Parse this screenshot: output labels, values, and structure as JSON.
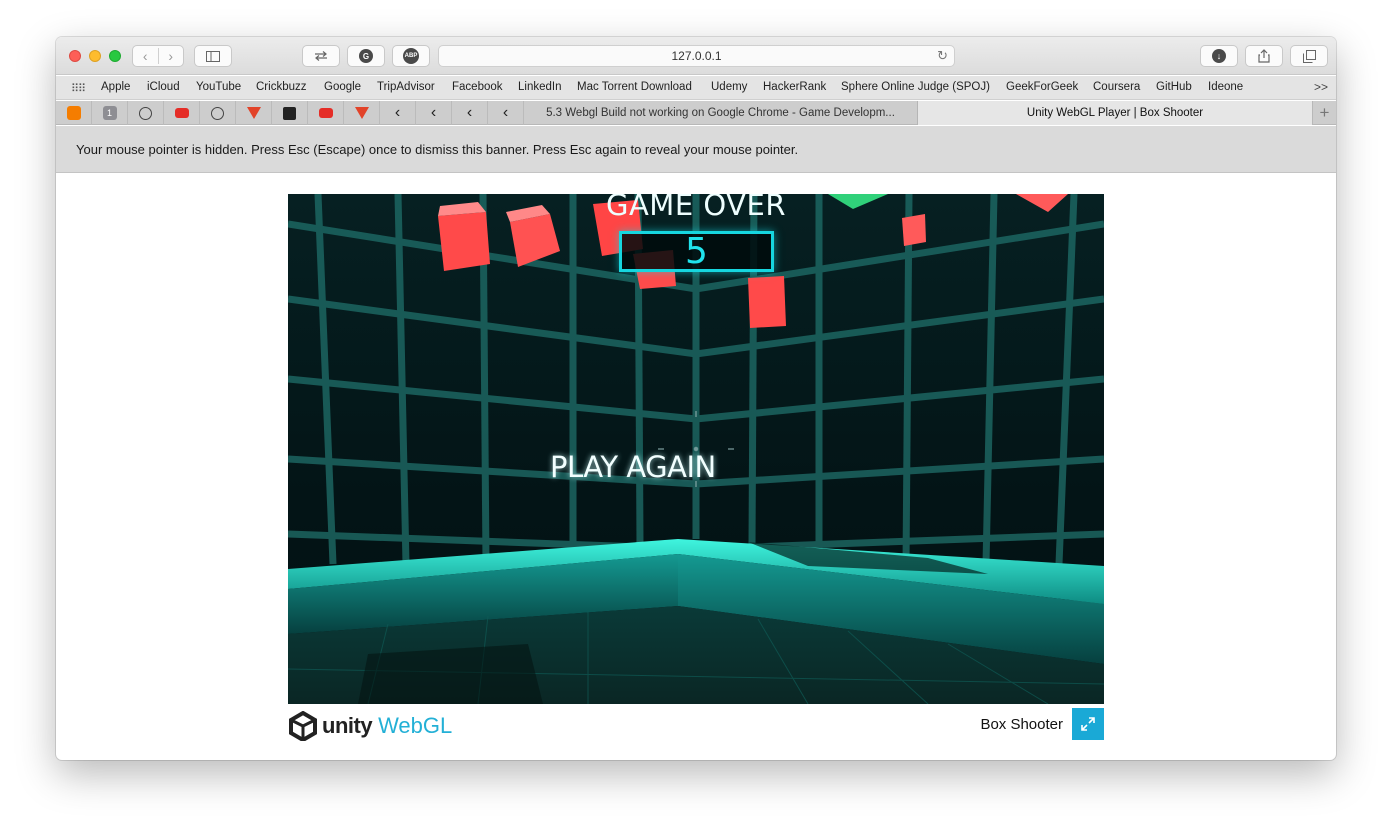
{
  "browser": {
    "address": "127.0.0.1",
    "bookmarks": [
      "Apple",
      "iCloud",
      "YouTube",
      "Crickbuzz",
      "Google",
      "TripAdvisor",
      "Facebook",
      "LinkedIn",
      "Mac Torrent Download",
      "Udemy",
      "HackerRank",
      "Sphere Online Judge (SPOJ)",
      "GeekForGeek",
      "Coursera",
      "GitHub",
      "Ideone"
    ],
    "bookmarks_more": ">>",
    "tabs": [
      {
        "title": "5.3 Webgl Build not working on Google Chrome - Game Developm...",
        "active": false
      },
      {
        "title": "Unity WebGL Player | Box Shooter",
        "active": true
      }
    ],
    "pinned_tab_badge": "1",
    "adblock_label": "ABP"
  },
  "banner": {
    "text": "Your mouse pointer is hidden. Press Esc (Escape) once to dismiss this banner. Press Esc again to reveal your mouse pointer."
  },
  "game": {
    "title_text": "GAME OVER",
    "score": "5",
    "play_again_label": "PLAY AGAIN"
  },
  "footer": {
    "unity_word": "unity",
    "webgl_word": "WebGL",
    "game_name": "Box Shooter"
  },
  "colors": {
    "accent": "#1aa9d6",
    "score_border": "#16d6df",
    "cube": "#ff4a4a"
  }
}
